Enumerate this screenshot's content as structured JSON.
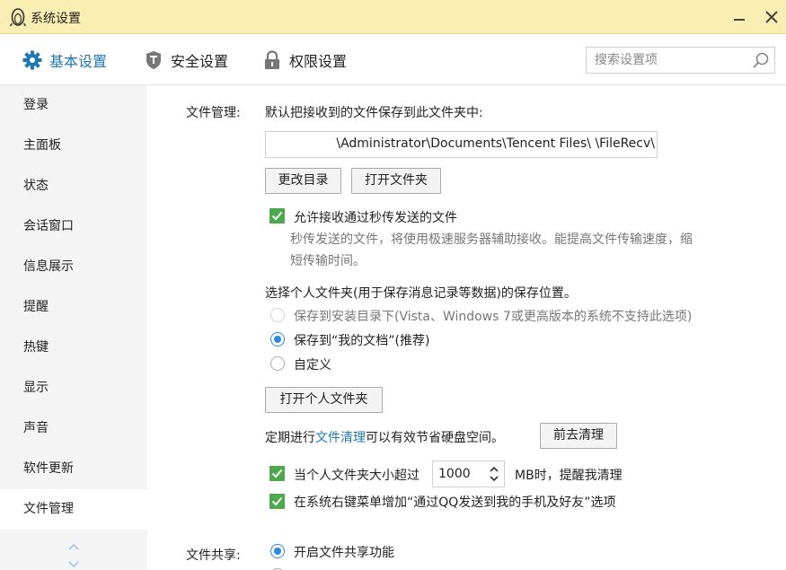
{
  "window": {
    "title": "系统设置"
  },
  "tabs": [
    {
      "label": "基本设置",
      "icon": "gear-icon",
      "active": true
    },
    {
      "label": "安全设置",
      "icon": "shield-icon",
      "active": false
    },
    {
      "label": "权限设置",
      "icon": "lock-icon",
      "active": false
    }
  ],
  "search": {
    "placeholder": "搜索设置项"
  },
  "sidebar": {
    "items": [
      {
        "label": "登录"
      },
      {
        "label": "主面板"
      },
      {
        "label": "状态"
      },
      {
        "label": "会话窗口"
      },
      {
        "label": "信息展示"
      },
      {
        "label": "提醒"
      },
      {
        "label": "热键"
      },
      {
        "label": "显示"
      },
      {
        "label": "声音"
      },
      {
        "label": "软件更新"
      },
      {
        "label": "文件管理",
        "active": true
      }
    ]
  },
  "file_management": {
    "section_label": "文件管理:",
    "save_to_label": "默认把接收到的文件保存到此文件夹中:",
    "path_value": "\\Administrator\\Documents\\Tencent Files\\                    \\FileRecv\\",
    "change_dir_button": "更改目录",
    "open_folder_button": "打开文件夹",
    "allow_flash_label": "允许接收通过秒传发送的文件",
    "allow_flash_checked": true,
    "allow_flash_desc": "秒传发送的文件，将使用极速服务器辅助接收。能提高文件传输速度，缩短传输时间。",
    "personal_folder_label": "选择个人文件夹(用于保存消息记录等数据)的保存位置。",
    "radio_options": [
      {
        "label": "保存到安装目录下(Vista、Windows 7或更高版本的系统不支持此选项)",
        "selected": false,
        "disabled": true
      },
      {
        "label": "保存到“我的文档”(推荐)",
        "selected": true,
        "disabled": false
      },
      {
        "label": "自定义",
        "selected": false,
        "disabled": false
      }
    ],
    "open_personal_button": "打开个人文件夹",
    "cleanup_prefix": "定期进行",
    "cleanup_link": "文件清理",
    "cleanup_suffix": "可以有效节省硬盘空间。",
    "cleanup_button": "前去清理",
    "size_warn_prefix": "当个人文件夹大小超过",
    "size_warn_value": "1000",
    "size_warn_suffix": "MB时，提醒我清理",
    "size_warn_checked": true,
    "context_menu_label": "在系统右键菜单增加“通过QQ发送到我的手机及好友”选项",
    "context_menu_checked": true
  },
  "file_sharing": {
    "section_label": "文件共享:",
    "enable_label": "开启文件共享功能",
    "enable_selected": true
  },
  "colors": {
    "titlebar": "#fbeeb3",
    "accent": "#1f78b4",
    "checkbox": "#4caa4c",
    "radio": "#2b8ae0"
  }
}
